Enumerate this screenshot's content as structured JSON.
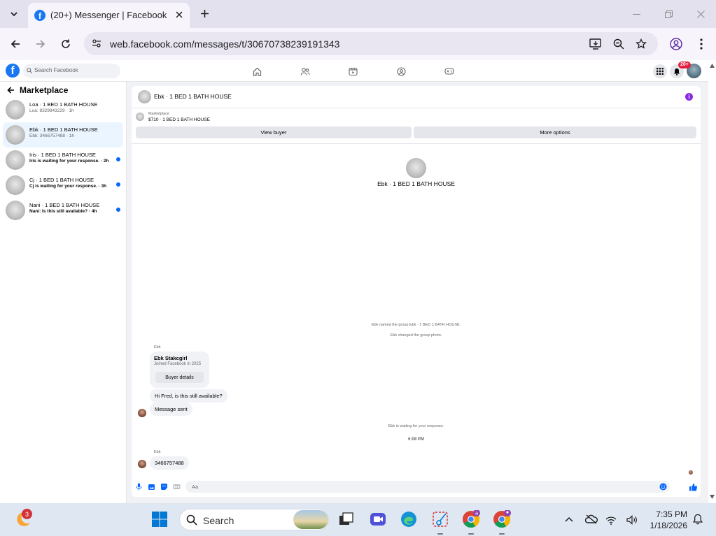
{
  "browser": {
    "tab_title": "(20+) Messenger | Facebook",
    "url": "web.facebook.com/messages/t/30670738239191343"
  },
  "facebook": {
    "search_placeholder": "Search Facebook",
    "notification_count": "20+"
  },
  "left_panel": {
    "title": "Marketplace",
    "conversations": [
      {
        "name": "Loa · 1 BED 1 BATH HOUSE",
        "preview": "Loa: 8329843229 · 1h",
        "unread": false,
        "active": false
      },
      {
        "name": "Ebk · 1 BED 1 BATH HOUSE",
        "preview": "Ebk: 3466757488 · 1h",
        "unread": false,
        "active": true
      },
      {
        "name": "Iris · 1 BED 1 BATH HOUSE",
        "preview": "Iris is waiting for your response. · 2h",
        "unread": true,
        "active": false
      },
      {
        "name": "Cj · 1 BED 1 BATH HOUSE",
        "preview": "Cj is waiting for your response. · 3h",
        "unread": true,
        "active": false
      },
      {
        "name": "Nani · 1 BED 1 BATH HOUSE",
        "preview": "Nani: Is this still available? · 4h",
        "unread": true,
        "active": false
      }
    ]
  },
  "chat": {
    "header_title": "Ebk · 1 BED 1 BATH HOUSE",
    "marketplace_label": "Marketplace",
    "listing": "$710 · 1 BED 1 BATH HOUSE",
    "view_buyer": "View buyer",
    "more_options": "More options",
    "intro_title": "Ebk · 1 BED 1 BATH HOUSE",
    "sys_named": "Ebk named the group Ebk · 1 BED 1 BATH HOUSE.",
    "sys_photo": "Ebk changed the group photo.",
    "sender_label_1": "Ebk",
    "card_name": "Ebk Stakcgirl",
    "card_joined": "Joined Facebook in 2025",
    "card_button": "Buyer details",
    "msg_1": "Hi Fred, is this still available?",
    "msg_2": "Message sent",
    "sys_waiting": "Ebk is waiting for your response.",
    "timestamp": "6:08 PM",
    "sender_label_2": "Ebk",
    "msg_3": "3466757488",
    "composer_placeholder": "Aa"
  },
  "taskbar": {
    "weather_badge": "3",
    "search_placeholder": "Search",
    "time": "7:35 PM",
    "date": "1/18/2026"
  },
  "colors": {
    "facebook_blue": "#1877f2",
    "messenger_blue": "#0866ff",
    "info_purple": "#8a2be2",
    "chrome_frame": "#e4e1ee"
  }
}
